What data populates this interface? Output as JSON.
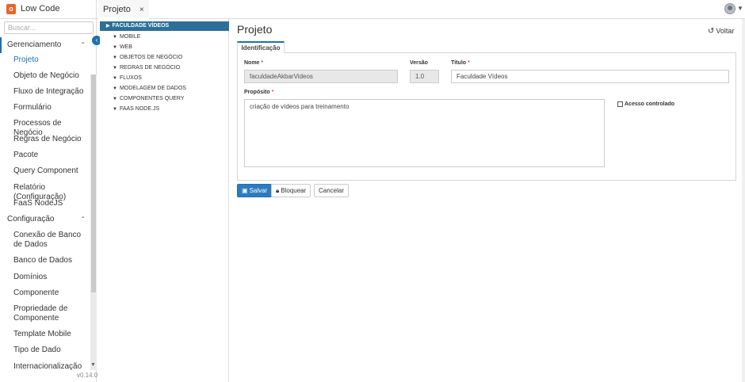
{
  "app": {
    "logo_letter": "o",
    "title": "Low Code"
  },
  "tabs": [
    {
      "label": "Projeto",
      "close": "×"
    }
  ],
  "sidebar": {
    "search_placeholder": "Buscar...",
    "groups": [
      {
        "label": "Gerenciamento",
        "chevron": "⌃",
        "items": [
          "Projeto",
          "Objeto de Negócio",
          "Fluxo de Integração",
          "Formulário",
          "Processos de Negócio",
          "Regras de Negócio",
          "Pacote",
          "Query Component",
          "Relatório (Configuração)",
          "FaaS NodeJS"
        ]
      },
      {
        "label": "Configuração",
        "chevron": "⌃",
        "items": [
          "Conexão de Banco de Dados",
          "Banco de Dados",
          "Domínios",
          "Componente",
          "Propriedade de Componente",
          "Template Mobile",
          "Tipo de Dado",
          "Internacionalização"
        ]
      }
    ],
    "version": "v0.14.0"
  },
  "tree": {
    "root": "FACULDADE VÍDEOS",
    "items": [
      "MOBILE",
      "WEB",
      "OBJETOS DE NEGÓCIO",
      "REGRAS DE NEGÓCIO",
      "FLUXOS",
      "MODELAGEM DE DADOS",
      "COMPONENTES QUERY",
      "FAAS NODE.JS"
    ]
  },
  "main": {
    "title": "Projeto",
    "back_label": "Voltar",
    "tab_label": "Identificação",
    "form": {
      "nome_label": "Nome",
      "nome_value": "faculdadeAkbarVideos",
      "versao_label": "Versão",
      "versao_value": "1.0",
      "titulo_label": "Título",
      "titulo_value": "Faculdade Vídeos",
      "proposito_label": "Propósito",
      "proposito_value": "criação de vídeos para treinamento",
      "acesso_label": "Acesso controlado",
      "required_mark": "*"
    },
    "buttons": {
      "save": "Salvar",
      "lock": "Bloquear",
      "cancel": "Cancelar"
    }
  },
  "colors": {
    "accent": "#1f6fb2",
    "tree_root_bg": "#2c6f9a",
    "logo": "#e8652b"
  }
}
